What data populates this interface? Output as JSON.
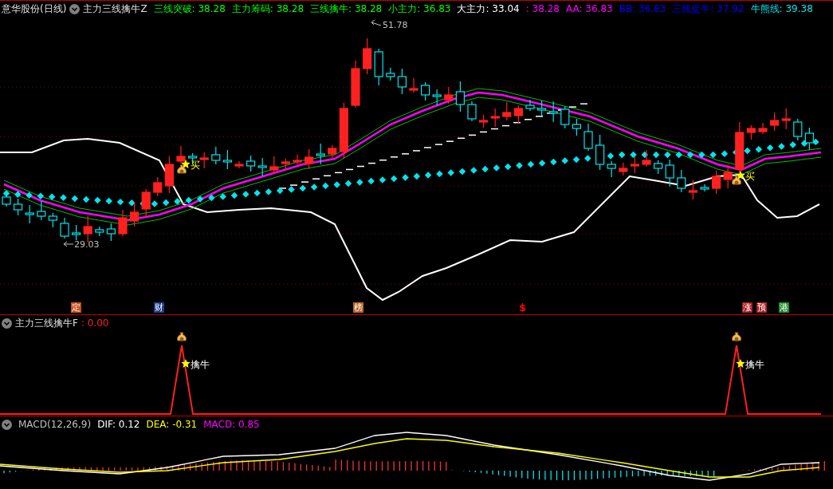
{
  "main_panel": {
    "stock_title": "意华股份(日线)",
    "indicator": "主力三线擒牛Z",
    "readings": [
      {
        "text": "三线突破: 38.28",
        "color": "#00ff00"
      },
      {
        "text": "主力筹码: 38.28",
        "color": "#00ff00"
      },
      {
        "text": "三线擒牛: 38.28",
        "color": "#00ff00"
      },
      {
        "text": "小主力: 36.83",
        "color": "#00ff00"
      },
      {
        "text": "大主力: 33.04",
        "color": "#ffffff"
      },
      {
        "text": ": 38.28",
        "color": "#ff00ff"
      },
      {
        "text": "AA: 36.83",
        "color": "#ff00ff"
      },
      {
        "text": "BB: 36.83",
        "color": "#0000ff"
      },
      {
        "text": "三线捉牛: 37.92",
        "color": "#0000ff"
      },
      {
        "text": "牛熊线: 39.38",
        "color": "#00e5ee"
      }
    ],
    "high_label": "51.78",
    "low_label": "29.03",
    "buy_signals": [
      {
        "text": "买"
      },
      {
        "text": "买"
      }
    ],
    "event_tags": [
      {
        "text": "定",
        "kind": "badge",
        "color": "#c8501a"
      },
      {
        "text": "财",
        "kind": "badge",
        "color": "#1e3f8f"
      },
      {
        "text": "榜",
        "kind": "badge",
        "color": "#b8641e"
      },
      {
        "text": "$",
        "kind": "text",
        "color": "#ff0000"
      },
      {
        "text": "涨",
        "kind": "badge",
        "color": "#a81e1e"
      },
      {
        "text": "预",
        "kind": "badge",
        "color": "#a81e1e"
      },
      {
        "text": "港",
        "kind": "badge",
        "color": "#1e8c28"
      }
    ]
  },
  "signal_panel": {
    "indicator": "主力三线擒牛F",
    "reading": ": 0.00",
    "signals": [
      {
        "text": "擒牛"
      },
      {
        "text": "擒牛"
      }
    ]
  },
  "macd_panel": {
    "readings": [
      {
        "text": "MACD(12,26,9)",
        "color": "#c0c0c0"
      },
      {
        "text": "DIF: 0.12",
        "color": "#ffffff"
      },
      {
        "text": "DEA: -0.31",
        "color": "#ffff00"
      },
      {
        "text": "MACD: 0.85",
        "color": "#ff00ff"
      }
    ]
  }
}
